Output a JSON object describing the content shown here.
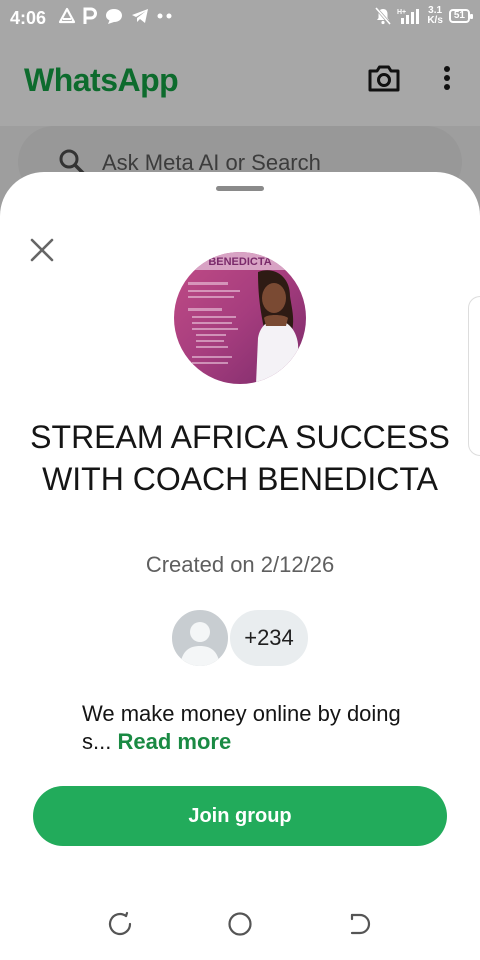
{
  "status_bar": {
    "time": "4:06",
    "left_icons": [
      "drive-warning-icon",
      "parking-icon",
      "chat-bubble-icon",
      "telegram-icon",
      "more-dots-icon"
    ],
    "right_icons": [
      "mute-icon",
      "signal-icon"
    ],
    "network_speed_value": "3.1",
    "network_speed_unit": "K/s",
    "battery": "51"
  },
  "app": {
    "title": "WhatsApp",
    "title_color": "#0d6b2d",
    "search_placeholder": "Ask Meta AI or Search"
  },
  "sheet": {
    "group_name": "STREAM AFRICA SUCCESS WITH COACH BENEDICTA",
    "avatar_banner_text": "BENEDICTA",
    "created_on": "Created on 2/12/26",
    "member_count": "+234",
    "description": "We make money online by doing s...",
    "read_more": "Read more",
    "join_button": "Join group",
    "accent_color": "#22ab5b"
  },
  "nav": {
    "buttons": [
      "recent-apps-icon",
      "home-icon",
      "back-icon"
    ]
  }
}
